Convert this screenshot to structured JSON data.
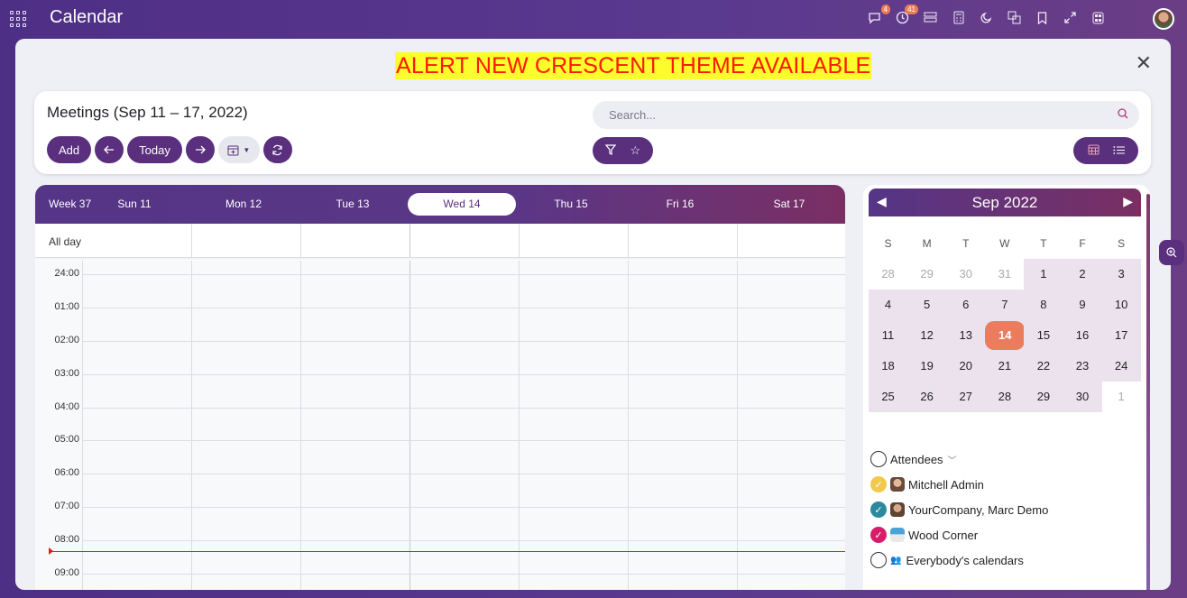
{
  "app": {
    "title": "Calendar"
  },
  "topbar": {
    "messages_badge": "4",
    "activities_badge": "41"
  },
  "alert": {
    "text": "ALERT NEW CRESCENT THEME AVAILABLE"
  },
  "control": {
    "title": "Meetings (Sep 11 – 17, 2022)",
    "add_label": "Add",
    "today_label": "Today",
    "search_placeholder": "Search..."
  },
  "week": {
    "label": "Week 37",
    "days": [
      "Sun 11",
      "Mon 12",
      "Tue 13",
      "Wed 14",
      "Thu 15",
      "Fri 16",
      "Sat 17"
    ],
    "today_index": 3,
    "allday_label": "All day",
    "hours": [
      "24:00",
      "01:00",
      "02:00",
      "03:00",
      "04:00",
      "05:00",
      "06:00",
      "07:00",
      "08:00",
      "09:00"
    ]
  },
  "mini_calendar": {
    "title": "Sep 2022",
    "dow": [
      "S",
      "M",
      "T",
      "W",
      "T",
      "F",
      "S"
    ],
    "weeks": [
      [
        "28",
        "29",
        "30",
        "31",
        "1",
        "2",
        "3"
      ],
      [
        "4",
        "5",
        "6",
        "7",
        "8",
        "9",
        "10"
      ],
      [
        "11",
        "12",
        "13",
        "14",
        "15",
        "16",
        "17"
      ],
      [
        "18",
        "19",
        "20",
        "21",
        "22",
        "23",
        "24"
      ],
      [
        "25",
        "26",
        "27",
        "28",
        "29",
        "30",
        "1"
      ]
    ],
    "selected": "14"
  },
  "attendees": {
    "header": "Attendees",
    "items": [
      {
        "name": "Mitchell Admin",
        "color": "#f2c94c",
        "checked": true
      },
      {
        "name": "YourCompany, Marc Demo",
        "color": "#2b8a9e",
        "checked": true
      },
      {
        "name": "Wood Corner",
        "color": "#d81b6a",
        "checked": true
      },
      {
        "name": "Everybody's calendars",
        "color": "",
        "checked": false
      }
    ]
  },
  "colors": {
    "primary": "#5a2f7e",
    "today_mini": "#ec7c5e",
    "alert_bg": "#fdfd2b",
    "alert_fg": "#ff1a00",
    "now_line": "#e31b1b"
  }
}
